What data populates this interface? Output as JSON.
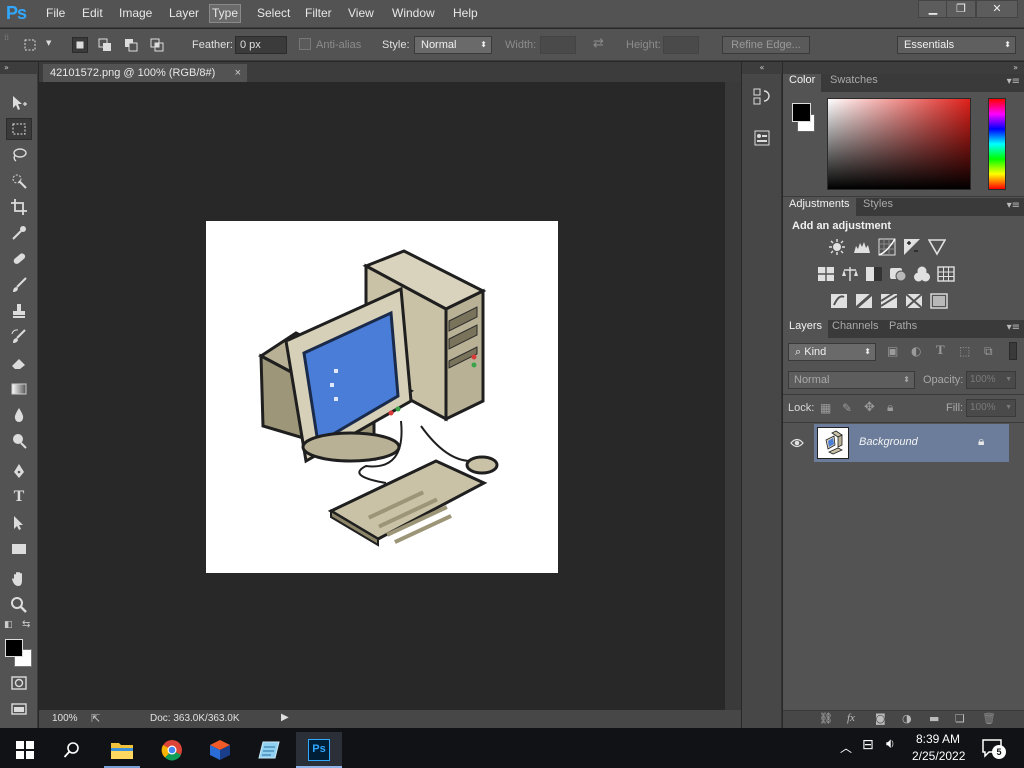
{
  "app": {
    "logo": "Ps"
  },
  "menu": [
    "File",
    "Edit",
    "Image",
    "Layer",
    "Type",
    "Select",
    "Filter",
    "View",
    "Window",
    "Help"
  ],
  "window_controls": {
    "minimize": "▁",
    "restore": "❐",
    "close": "✕"
  },
  "options": {
    "feather_label": "Feather:",
    "feather_value": "0 px",
    "antialias_label": "Anti-alias",
    "style_label": "Style:",
    "style_value": "Normal",
    "width_label": "Width:",
    "height_label": "Height:",
    "refine_edge": "Refine Edge...",
    "workspace": "Essentials"
  },
  "document": {
    "tab_title": "42101572.png @ 100% (RGB/8#)",
    "close": "×",
    "zoom": "100%",
    "doc_info": "Doc: 363.0K/363.0K"
  },
  "color_panel": {
    "tabs": [
      "Color",
      "Swatches"
    ]
  },
  "adjustments_panel": {
    "tabs": [
      "Adjustments",
      "Styles"
    ],
    "heading": "Add an adjustment"
  },
  "layers_panel": {
    "tabs": [
      "Layers",
      "Channels",
      "Paths"
    ],
    "filter_kind": "Kind",
    "blend_mode": "Normal",
    "opacity_label": "Opacity:",
    "opacity_value": "100%",
    "lock_label": "Lock:",
    "fill_label": "Fill:",
    "fill_value": "100%",
    "layers": [
      {
        "name": "Background",
        "locked": true,
        "visible": true
      }
    ]
  },
  "taskbar": {
    "time": "8:39 AM",
    "date": "2/25/2022",
    "notification_count": "5"
  },
  "colors": {
    "accent_ps": "#31a8ff",
    "panel_bg": "#535353",
    "canvas_bg": "#282828",
    "layer_selected": "#5d6f8c"
  }
}
